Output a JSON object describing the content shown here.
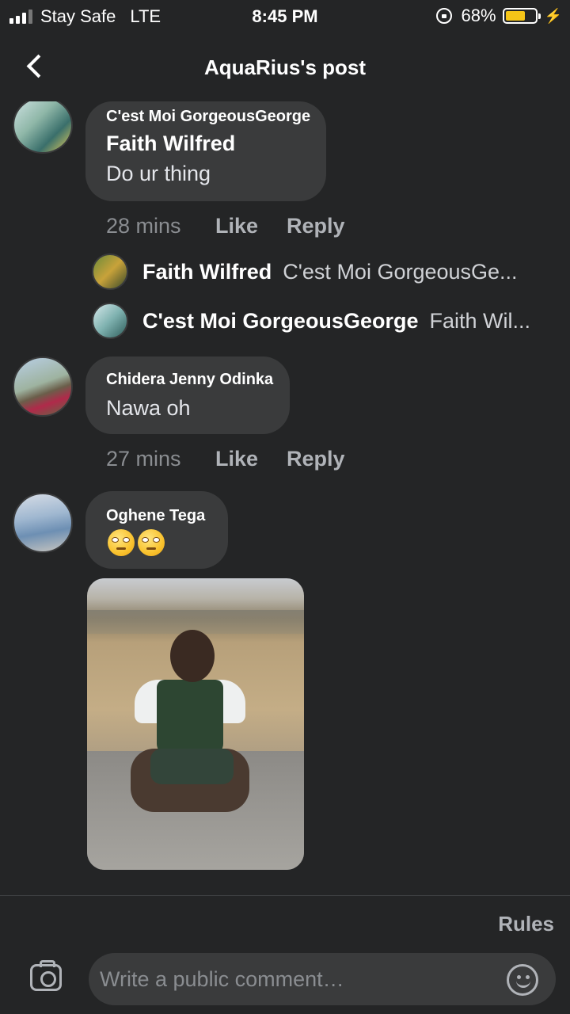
{
  "status_bar": {
    "carrier": "Stay Safe",
    "network": "LTE",
    "time": "8:45 PM",
    "battery_percent": "68%",
    "battery_level": 0.68,
    "icons": [
      "signal-icon",
      "rotation-lock-icon",
      "battery-icon",
      "charging-icon"
    ]
  },
  "header": {
    "title": "AquaRius's post",
    "back_icon": "chevron-left-icon"
  },
  "comments": [
    {
      "author": "C'est Moi GorgeousGeorge",
      "tagged": "Faith Wilfred",
      "text": "Do ur thing",
      "time": "28 mins",
      "like_label": "Like",
      "reply_label": "Reply",
      "replies": [
        {
          "author": "Faith Wilfred",
          "preview": "C'est Moi GorgeousGe..."
        },
        {
          "author": "C'est Moi GorgeousGeorge",
          "preview": "Faith Wil..."
        }
      ]
    },
    {
      "author": "Chidera Jenny Odinka",
      "text": "Nawa oh",
      "time": "27 mins",
      "like_label": "Like",
      "reply_label": "Reply"
    },
    {
      "author": "Oghene Tega",
      "emoji": [
        "face-with-rolling-eyes",
        "face-with-rolling-eyes"
      ],
      "has_photo": true
    }
  ],
  "footer": {
    "rules_label": "Rules",
    "comment_placeholder": "Write a public comment…",
    "camera_icon": "camera-icon",
    "emoji_icon": "smiley-icon"
  },
  "colors": {
    "background": "#242526",
    "bubble": "#3a3b3c",
    "muted_text": "#8a8d91",
    "battery": "#f5c518"
  }
}
